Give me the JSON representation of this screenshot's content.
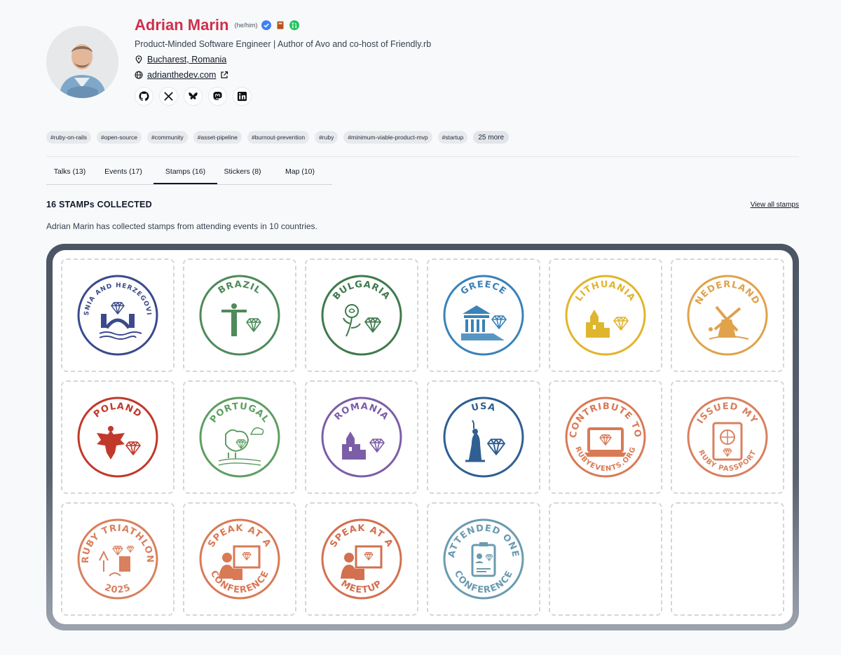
{
  "profile": {
    "name": "Adrian Marin",
    "pronouns": "(he/him)",
    "bio": "Product-Minded Software Engineer | Author of Avo and co-host of Friendly.rb",
    "location": "Bucharest, Romania",
    "website": "adrianthedev.com",
    "badges": [
      "verified-icon",
      "book-icon",
      "pull-request-icon"
    ],
    "socials": [
      "github-icon",
      "x-icon",
      "bluesky-icon",
      "mastodon-icon",
      "linkedin-icon"
    ],
    "colors": {
      "name": "#cf2f4b",
      "verified": "#3b82f6",
      "book": "#b4541f",
      "pr": "#22c55e"
    }
  },
  "tags": [
    "#ruby-on-rails",
    "#open-source",
    "#community",
    "#asset-pipeline",
    "#burnout-prevention",
    "#ruby",
    "#minimum-viable-product-mvp",
    "#startup"
  ],
  "tags_more": "25 more",
  "tabs": [
    {
      "label": "Talks (13)"
    },
    {
      "label": "Events (17)"
    },
    {
      "label": "Stamps (16)",
      "active": true
    },
    {
      "label": "Stickers (8)"
    },
    {
      "label": "Map (10)"
    }
  ],
  "section": {
    "title": "16 STAMPs COLLECTED",
    "view_all": "View all stamps",
    "summary": "Adrian Marin has collected stamps from attending events in 10 countries."
  },
  "stamps": [
    {
      "top": "BOSNIA AND HERZEGOVINA",
      "bottom": "",
      "color": "#3b4a8c",
      "icon": "bridge-icon"
    },
    {
      "top": "BRAZIL",
      "bottom": "",
      "color": "#4e8a5a",
      "icon": "christ-statue-icon"
    },
    {
      "top": "BULGARIA",
      "bottom": "",
      "color": "#3f7a4d",
      "icon": "rose-icon"
    },
    {
      "top": "GREECE",
      "bottom": "",
      "color": "#3a82b8",
      "icon": "temple-icon"
    },
    {
      "top": "LITHUANIA",
      "bottom": "",
      "color": "#e0b52e",
      "icon": "castle-icon"
    },
    {
      "top": "NEDERLAND",
      "bottom": "",
      "color": "#e0a24a",
      "icon": "windmill-icon"
    },
    {
      "top": "POLAND",
      "bottom": "",
      "color": "#c0392b",
      "icon": "eagle-icon"
    },
    {
      "top": "PORTUGAL",
      "bottom": "",
      "color": "#5e9e62",
      "icon": "rooster-icon"
    },
    {
      "top": "ROMANIA",
      "bottom": "",
      "color": "#7c5ea7",
      "icon": "castle-icon"
    },
    {
      "top": "USA",
      "bottom": "",
      "color": "#2f5f93",
      "icon": "liberty-icon"
    },
    {
      "top": "CONTRIBUTE TO",
      "bottom": "RUBYEVENTS.ORG",
      "color": "#d97a55",
      "icon": "laptop-icon"
    },
    {
      "top": "ISSUED MY",
      "bottom": "RUBY PASSPORT",
      "color": "#d9805e",
      "icon": "passport-icon"
    },
    {
      "top": "RUBY TRIATHLON",
      "bottom": "2025",
      "color": "#d9805e",
      "icon": "landmarks-icon"
    },
    {
      "top": "SPEAK AT A",
      "bottom": "CONFERENCE",
      "color": "#d97a55",
      "icon": "speaker-icon"
    },
    {
      "top": "SPEAK AT A",
      "bottom": "MEETUP",
      "color": "#d2704f",
      "icon": "speaker-icon"
    },
    {
      "top": "ATTENDED ONE",
      "bottom": "CONFERENCE",
      "color": "#6a9bb0",
      "icon": "badge-icon"
    }
  ],
  "empty_slots": 2
}
